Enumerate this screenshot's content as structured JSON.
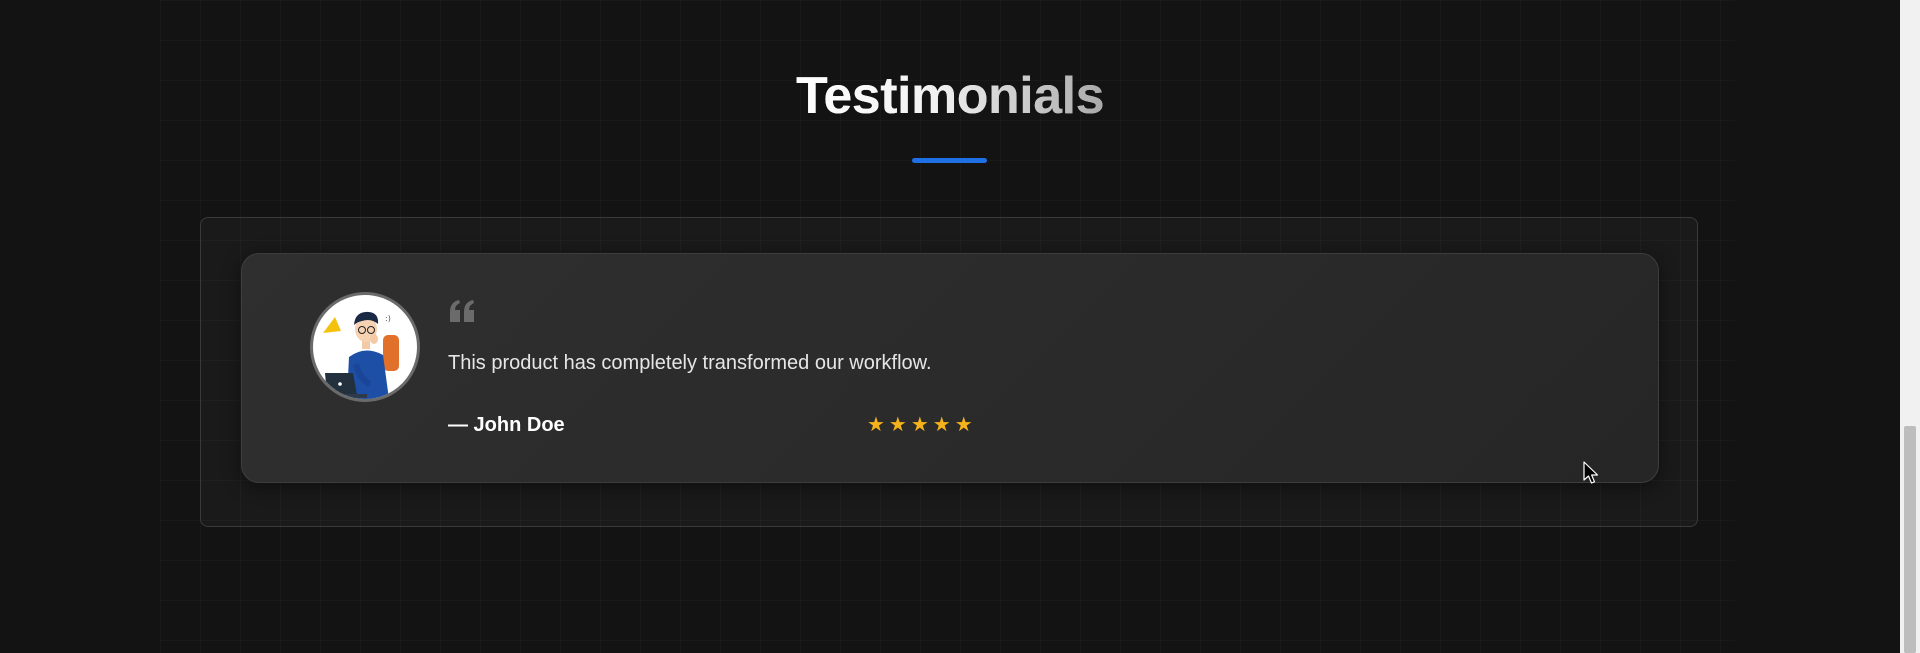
{
  "section": {
    "title": "Testimonials",
    "accent_color": "#1f6fe5"
  },
  "testimonial": {
    "quote": "This product has completely transformed our workflow.",
    "author": "— John Doe",
    "rating": 5,
    "stars": "★★★★★",
    "star_color": "#f5b21b",
    "avatar_icon": "person-with-laptop-illustration",
    "quote_icon": "quote-left-icon"
  }
}
